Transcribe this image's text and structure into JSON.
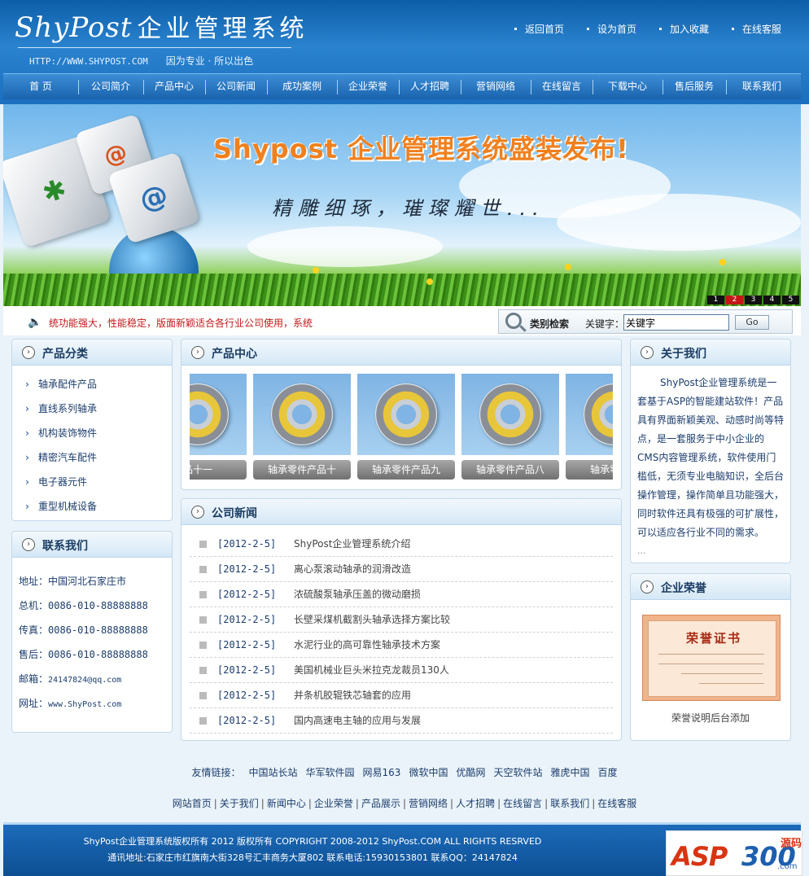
{
  "header": {
    "brand": "ShyPost",
    "brand_cn": "企业管理系统",
    "url": "HTTP://WWW.SHYPOST.COM",
    "slogan": "因为专业 · 所以出色",
    "top_links": [
      "返回首页",
      "设为首页",
      "加入收藏",
      "在线客服"
    ]
  },
  "nav": [
    {
      "label": "首 页",
      "w": 92
    },
    {
      "label": "公司简介",
      "w": 80
    },
    {
      "label": "产品中心",
      "w": 76
    },
    {
      "label": "公司新闻",
      "w": 76
    },
    {
      "label": "成功案例",
      "w": 86
    },
    {
      "label": "企业荣誉",
      "w": 76
    },
    {
      "label": "人才招聘",
      "w": 76
    },
    {
      "label": "营销网络",
      "w": 86
    },
    {
      "label": "在线留言",
      "w": 76
    },
    {
      "label": "下载中心",
      "w": 86
    },
    {
      "label": "售后服务",
      "w": 78
    },
    {
      "label": "联系我们",
      "w": 88
    }
  ],
  "banner": {
    "title": "Shypost 企业管理系统盛装发布!",
    "subtitle": "精雕细琢，璀璨耀世...",
    "slides": [
      "1",
      "2",
      "3",
      "4",
      "5"
    ],
    "active_slide": "2"
  },
  "ticker": {
    "text": "统功能强大，性能稳定，版面新颖适合各行业公司使用，系统"
  },
  "search": {
    "title": "类别检索",
    "keyword_label": "关键字：",
    "keyword_value": "关键字",
    "go_label": "Go"
  },
  "categories": {
    "title": "产品分类",
    "items": [
      "轴承配件产品",
      "直线系列轴承",
      "机构装饰物件",
      "精密汽车配件",
      "电子器元件",
      "重型机械设备"
    ]
  },
  "contact": {
    "title": "联系我们",
    "rows": [
      {
        "label": "地址：",
        "value": "中国河北石家庄市"
      },
      {
        "label": "总机：",
        "value": "0086-010-88888888"
      },
      {
        "label": "传真：",
        "value": "0086-010-88888888"
      },
      {
        "label": "售后：",
        "value": "0086-010-88888888"
      },
      {
        "label": "邮箱：",
        "value": "24147824@qq.com"
      },
      {
        "label": "网址：",
        "value": "www.ShyPost.com"
      }
    ]
  },
  "products": {
    "title": "产品中心",
    "items": [
      {
        "name": "品十一"
      },
      {
        "name": "轴承零件产品十"
      },
      {
        "name": "轴承零件产品九"
      },
      {
        "name": "轴承零件产品八"
      },
      {
        "name": "轴承零件产"
      }
    ]
  },
  "news": {
    "title": "公司新闻",
    "items": [
      {
        "date": "[2012-2-5]",
        "title": "ShyPost企业管理系统介绍"
      },
      {
        "date": "[2012-2-5]",
        "title": "离心泵滚动轴承的润滑改造"
      },
      {
        "date": "[2012-2-5]",
        "title": "浓硫酸泵轴承压盖的微动磨损"
      },
      {
        "date": "[2012-2-5]",
        "title": "长壁采煤机截割头轴承选择方案比较"
      },
      {
        "date": "[2012-2-5]",
        "title": "水泥行业的高可靠性轴承技术方案"
      },
      {
        "date": "[2012-2-5]",
        "title": "美国机械业巨头米拉克龙裁员130人"
      },
      {
        "date": "[2012-2-5]",
        "title": "并条机胶辊铁芯轴套的应用"
      },
      {
        "date": "[2012-2-5]",
        "title": "国内高速电主轴的应用与发展"
      }
    ]
  },
  "about": {
    "title": "关于我们",
    "text": "ShyPost企业管理系统是一套基于ASP的智能建站软件！产品具有界面新颖美观、动感时尚等特点，是一套服务于中小企业的CMS内容管理系统，软件使用门槛低，无须专业电脑知识，全后台操作管理，操作简单且功能强大，同时软件还具有极强的可扩展性，可以适应各行业不同的需求。",
    "more": "..."
  },
  "honor": {
    "title": "企业荣誉",
    "cert_title": "荣誉证书",
    "caption": "荣誉说明后台添加"
  },
  "friend_links": {
    "label": "友情链接：",
    "items": [
      "中国站长站",
      "华军软件园",
      "网易163",
      "微软中国",
      "优酷网",
      "天空软件站",
      "雅虎中国",
      "百度"
    ]
  },
  "bottom_nav": [
    "网站首页",
    "关于我们",
    "新闻中心",
    "企业荣誉",
    "产品展示",
    "营销网络",
    "人才招聘",
    "在线留言",
    "联系我们",
    "在线客服"
  ],
  "footer": {
    "copyright": "ShyPost企业管理系统版权所有 2012 版权所有 COPYRIGHT 2008-2012 ShyPost.COM ALL RIGHTS RESRVED",
    "address": "通讯地址:石家庄市红旗南大街328号汇丰商务大厦802 联系电话:15930153801 联系QQ：24147824"
  },
  "watermark": {
    "text1": "ASP",
    "text2": "300",
    "text3": "源码",
    "text4": ".com"
  }
}
